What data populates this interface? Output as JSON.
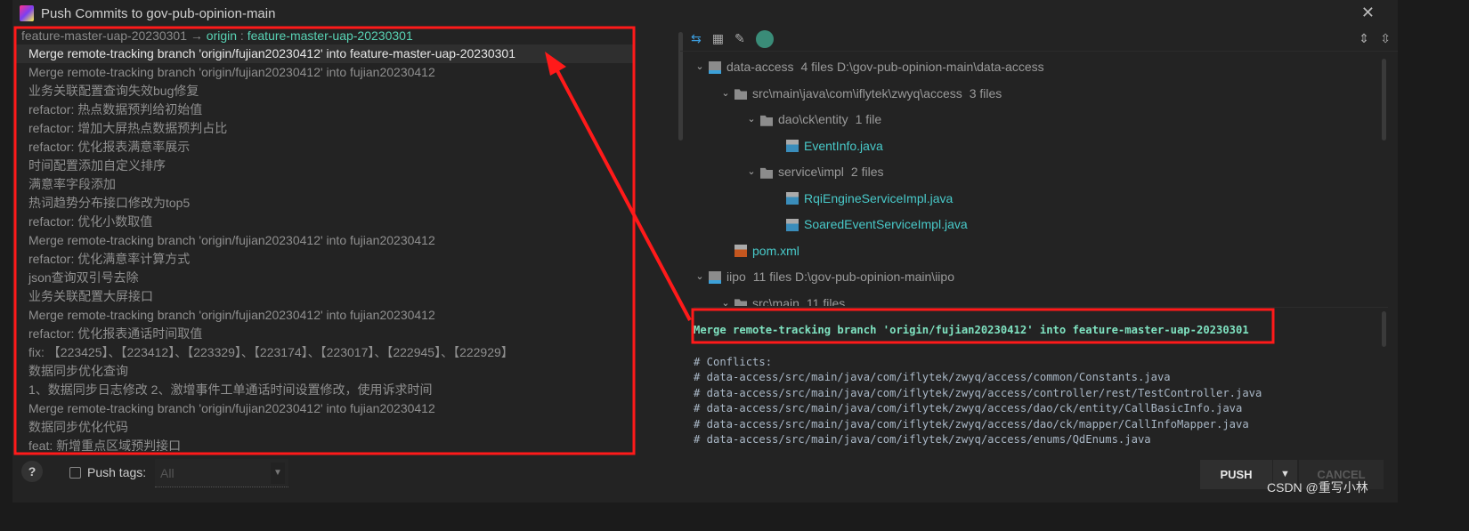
{
  "title": "Push Commits to gov-pub-opinion-main",
  "branch": {
    "local": "feature-master-uap-20230301",
    "arrow": "→",
    "remote": "origin",
    "sep": " : ",
    "remote_branch": "feature-master-uap-20230301"
  },
  "commits": [
    "Merge remote-tracking branch 'origin/fujian20230412' into feature-master-uap-20230301",
    "Merge remote-tracking branch 'origin/fujian20230412' into fujian20230412",
    "业务关联配置查询失效bug修复",
    "refactor: 热点数据预判给初始值",
    "refactor: 增加大屏热点数据预判占比",
    "refactor: 优化报表满意率展示",
    "时间配置添加自定义排序",
    "满意率字段添加",
    "热词趋势分布接口修改为top5",
    "refactor: 优化小数取值",
    "Merge remote-tracking branch 'origin/fujian20230412' into fujian20230412",
    "refactor: 优化满意率计算方式",
    "json查询双引号去除",
    "业务关联配置大屏接口",
    "Merge remote-tracking branch 'origin/fujian20230412' into fujian20230412",
    "refactor: 优化报表通话时间取值",
    "fix: 【223425】、【223412】、【223329】、【223174】、【223017】、【222945】、【222929】",
    "数据同步优化查询",
    "1、数据同步日志修改 2、激增事件工单通话时间设置修改，使用诉求时间",
    "Merge remote-tracking branch 'origin/fujian20230412' into fujian20230412",
    "数据同步优化代码",
    "feat: 新增重点区域预判接口"
  ],
  "tree": [
    {
      "level": 0,
      "chevron": true,
      "icon": "module",
      "name": "data-access",
      "meta": "4 files  D:\\gov-pub-opinion-main\\data-access"
    },
    {
      "level": 1,
      "chevron": true,
      "icon": "folder",
      "name": "src\\main\\java\\com\\iflytek\\zwyq\\access",
      "meta": "3 files"
    },
    {
      "level": 2,
      "chevron": true,
      "icon": "folder",
      "name": "dao\\ck\\entity",
      "meta": "1 file"
    },
    {
      "level": 3,
      "chevron": false,
      "icon": "java",
      "name": "EventInfo.java",
      "meta": ""
    },
    {
      "level": 2,
      "chevron": true,
      "icon": "folder",
      "name": "service\\impl",
      "meta": "2 files"
    },
    {
      "level": 3,
      "chevron": false,
      "icon": "java",
      "name": "RqiEngineServiceImpl.java",
      "meta": ""
    },
    {
      "level": 3,
      "chevron": false,
      "icon": "java",
      "name": "SoaredEventServiceImpl.java",
      "meta": ""
    },
    {
      "level": 1,
      "chevron": false,
      "icon": "xml",
      "name": "pom.xml",
      "meta": ""
    },
    {
      "level": 0,
      "chevron": true,
      "icon": "module",
      "name": "iipo",
      "meta": "11 files  D:\\gov-pub-opinion-main\\iipo"
    },
    {
      "level": 1,
      "chevron": true,
      "icon": "folder",
      "name": "src\\main",
      "meta": "11 files"
    }
  ],
  "message": {
    "first": "Merge remote-tracking branch 'origin/fujian20230412' into feature-master-uap-20230301",
    "lines": [
      "# Conflicts:",
      "# data-access/src/main/java/com/iflytek/zwyq/access/common/Constants.java",
      "# data-access/src/main/java/com/iflytek/zwyq/access/controller/rest/TestController.java",
      "# data-access/src/main/java/com/iflytek/zwyq/access/dao/ck/entity/CallBasicInfo.java",
      "# data-access/src/main/java/com/iflytek/zwyq/access/dao/ck/mapper/CallInfoMapper.java",
      "# data-access/src/main/java/com/iflytek/zwyq/access/enums/QdEnums.java"
    ]
  },
  "bottom": {
    "help": "?",
    "push_tags_label": "Push tags:",
    "tags_value": "All",
    "push": "PUSH",
    "cancel": "CANCEL"
  },
  "watermark": "CSDN @重写小林",
  "colors": {
    "accent": "#59d2b4",
    "annotation": "#ff1a1a",
    "file": "#48c9c9"
  }
}
